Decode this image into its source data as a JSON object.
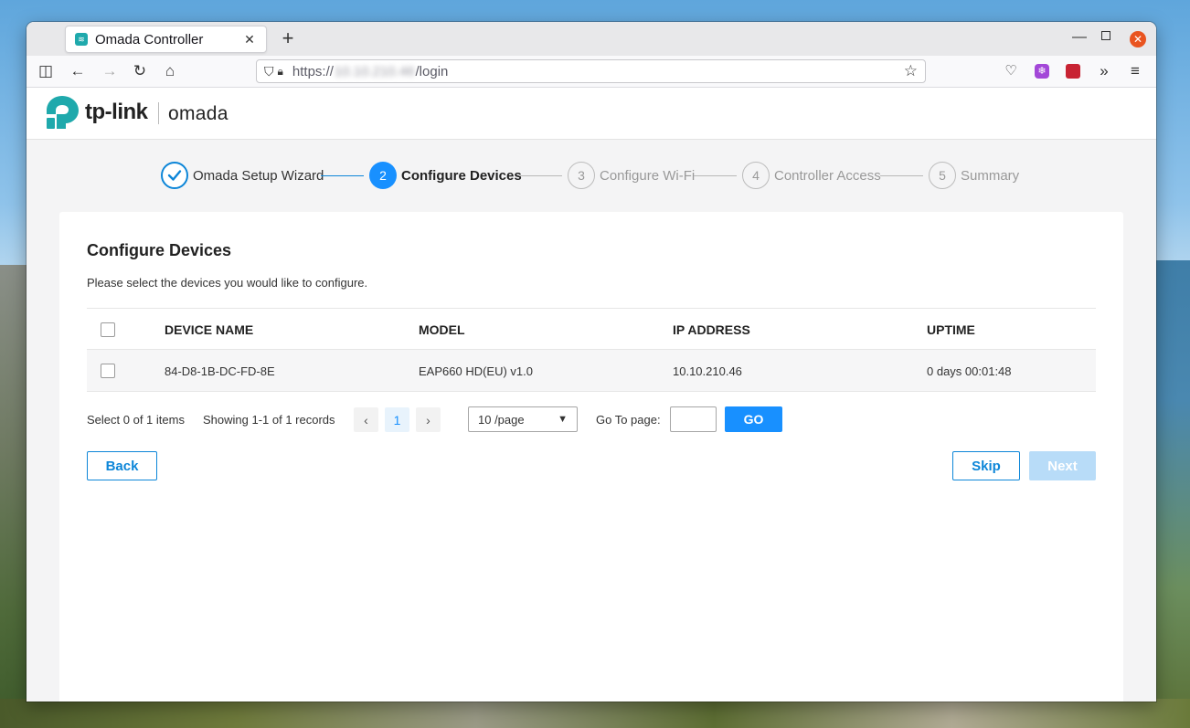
{
  "browser": {
    "tab_title": "Omada Controller",
    "url_scheme": "https://",
    "url_host": "10.10.210.46",
    "url_path": "/login",
    "icons": [
      "sidebar-icon",
      "back-icon",
      "forward-icon",
      "reload-icon",
      "home-icon",
      "shield-icon",
      "lock-icon",
      "star-icon",
      "pocket-icon",
      "extension-icon",
      "overflow-icon",
      "menu-icon"
    ]
  },
  "brand": {
    "tplink": "tp-link",
    "omada": "omada",
    "color": "#1fa9ac"
  },
  "wizard": {
    "steps": [
      {
        "number": "1",
        "label": "Omada Setup Wizard",
        "state": "done"
      },
      {
        "number": "2",
        "label": "Configure Devices",
        "state": "active"
      },
      {
        "number": "3",
        "label": "Configure Wi-Fi",
        "state": "pending"
      },
      {
        "number": "4",
        "label": "Controller Access",
        "state": "pending"
      },
      {
        "number": "5",
        "label": "Summary",
        "state": "pending"
      }
    ],
    "accent": "#1890ff"
  },
  "page": {
    "title": "Configure Devices",
    "description": "Please select the devices you would like to configure."
  },
  "table": {
    "columns": [
      "DEVICE NAME",
      "MODEL",
      "IP ADDRESS",
      "UPTIME"
    ],
    "rows": [
      [
        "84-D8-1B-DC-FD-8E",
        "EAP660 HD(EU) v1.0",
        "10.10.210.46",
        "0 days 00:01:48"
      ]
    ]
  },
  "pagination": {
    "selected_text": "Select 0 of 1 items",
    "showing_text": "Showing 1-1 of 1 records",
    "current_page": "1",
    "page_size": "10 /page",
    "goto_label": "Go To page:",
    "goto_value": "",
    "go_label": "GO"
  },
  "actions": {
    "back": "Back",
    "skip": "Skip",
    "next": "Next"
  }
}
